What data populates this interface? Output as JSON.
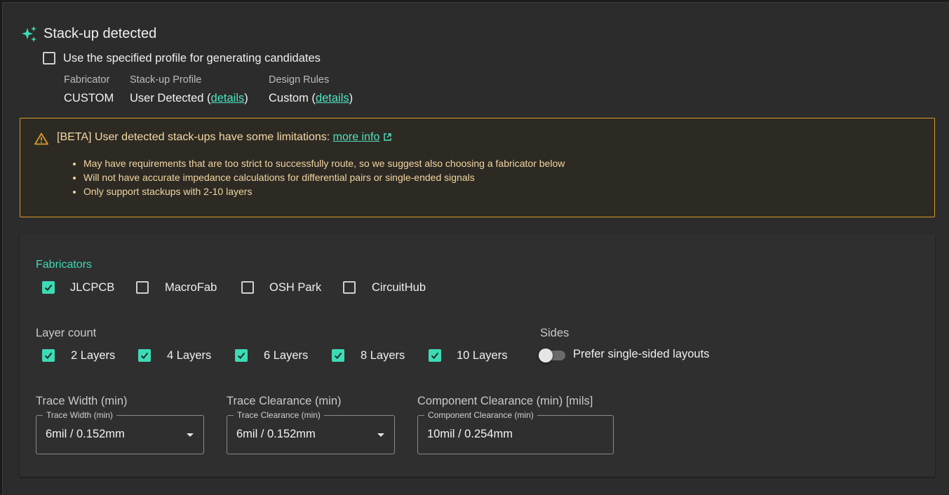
{
  "header": {
    "title": "Stack-up detected",
    "icon": "sparkle-icon",
    "use_profile_label": "Use the specified profile for generating candidates",
    "use_profile_checked": false
  },
  "profile": {
    "fabricator": {
      "label": "Fabricator",
      "value": "CUSTOM"
    },
    "stackup": {
      "label": "Stack-up Profile",
      "value_prefix": "User Detected (",
      "link": "details",
      "value_suffix": ")"
    },
    "rules": {
      "label": "Design Rules",
      "value_prefix": "Custom (",
      "link": "details",
      "value_suffix": ")"
    }
  },
  "warning": {
    "icon": "warning-icon",
    "title": "[BETA] User detected stack-ups have some limitations:",
    "link": "more info",
    "link_icon": "external-link-icon",
    "items": [
      "May have requirements that are too strict to successfully route, so we suggest also choosing a fabricator below",
      "Will not have accurate impedance calculations for differential pairs or single-ended signals",
      "Only support stackups with 2-10 layers"
    ],
    "color": "#d99a2b"
  },
  "fabricators": {
    "title": "Fabricators",
    "options": [
      {
        "label": "JLCPCB",
        "checked": true
      },
      {
        "label": "MacroFab",
        "checked": false
      },
      {
        "label": "OSH Park",
        "checked": false
      },
      {
        "label": "CircuitHub",
        "checked": false
      }
    ]
  },
  "layer_count": {
    "title": "Layer count",
    "options": [
      {
        "label": "2 Layers",
        "checked": true
      },
      {
        "label": "4 Layers",
        "checked": true
      },
      {
        "label": "6 Layers",
        "checked": true
      },
      {
        "label": "8 Layers",
        "checked": true
      },
      {
        "label": "10 Layers",
        "checked": true
      }
    ]
  },
  "sides": {
    "title": "Sides",
    "toggle_label": "Prefer single-sided layouts",
    "enabled": false
  },
  "fields": {
    "trace_width": {
      "title": "Trace Width (min)",
      "legend": "Trace Width (min)",
      "value": "6mil / 0.152mm",
      "dropdown": true
    },
    "trace_clearance": {
      "title": "Trace Clearance (min)",
      "legend": "Trace Clearance (min)",
      "value": "6mil / 0.152mm",
      "dropdown": true
    },
    "component_clearance": {
      "title": "Component Clearance (min) [mils]",
      "legend": "Component Clearance (min)",
      "value": "10mil / 0.254mm",
      "dropdown": false
    }
  },
  "colors": {
    "accent": "#3ddbb4",
    "background": "#2c2c2c",
    "panel": "#2f2f2f"
  }
}
